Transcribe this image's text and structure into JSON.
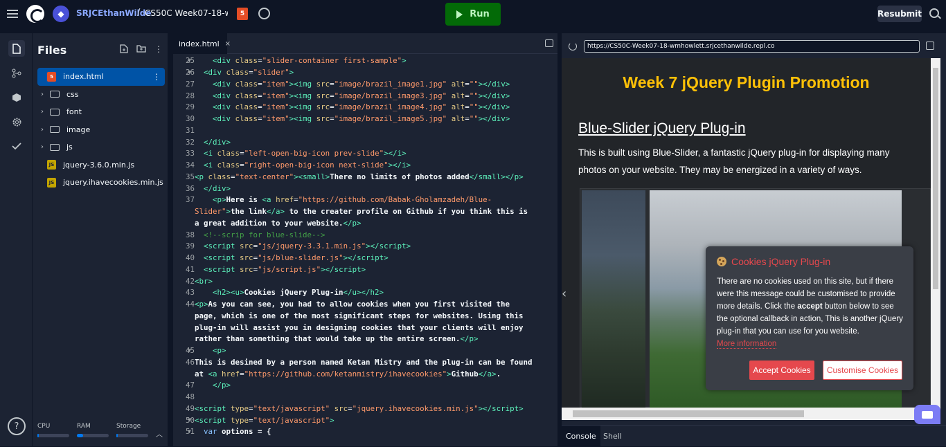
{
  "topbar": {
    "owner": "SRJCEthanWilde",
    "separator": "/",
    "repl_name": "CS50C Week07-18-w...",
    "run_label": "Run",
    "resubmit_label": "Resubmit"
  },
  "files_panel": {
    "title": "Files",
    "items": [
      {
        "name": "index.html",
        "type": "file-html",
        "selected": true
      },
      {
        "name": "css",
        "type": "folder"
      },
      {
        "name": "font",
        "type": "folder"
      },
      {
        "name": "image",
        "type": "folder"
      },
      {
        "name": "js",
        "type": "folder"
      },
      {
        "name": "jquery-3.6.0.min.js",
        "type": "file-js"
      },
      {
        "name": "jquery.ihavecookies.min.js",
        "type": "file-js"
      }
    ],
    "resources": [
      {
        "label": "CPU",
        "level": 0.05
      },
      {
        "label": "RAM",
        "level": 0.2
      },
      {
        "label": "Storage",
        "level": 0.05
      }
    ]
  },
  "editor": {
    "tab_label": "index.html",
    "tab_close": "×"
  },
  "preview": {
    "url": "https://CS50C-Week07-18-wmhowlett.srjcethanwilde.repl.co",
    "heading": "Week 7 jQuery Plugin Promotion",
    "subheading": "Blue-Slider jQuery Plug-in",
    "paragraph": "This is built using Blue-Slider, a fantastic jQuery plug-in for displaying many photos on your website. They may be energized in a variety of ways.",
    "cookie": {
      "title": "Cookies jQuery Plug-in",
      "text_before": "There are no cookies used on this site, but if there were this message could be customised to provide more details. Click the ",
      "accept_word": "accept",
      "text_after": " button below to see the optional callback in action, This is another jQuery plug-in that you can use for you website.",
      "more_info": "More information",
      "accept_button": "Accept Cookies",
      "customise_button": "Customise Cookies"
    }
  },
  "console_tabs": [
    "Console",
    "Shell"
  ],
  "colors": {
    "run_green": "#036a07",
    "heading_yellow": "#ffc107",
    "cookie_red": "#e5484d",
    "selected_file": "#0053a6"
  }
}
